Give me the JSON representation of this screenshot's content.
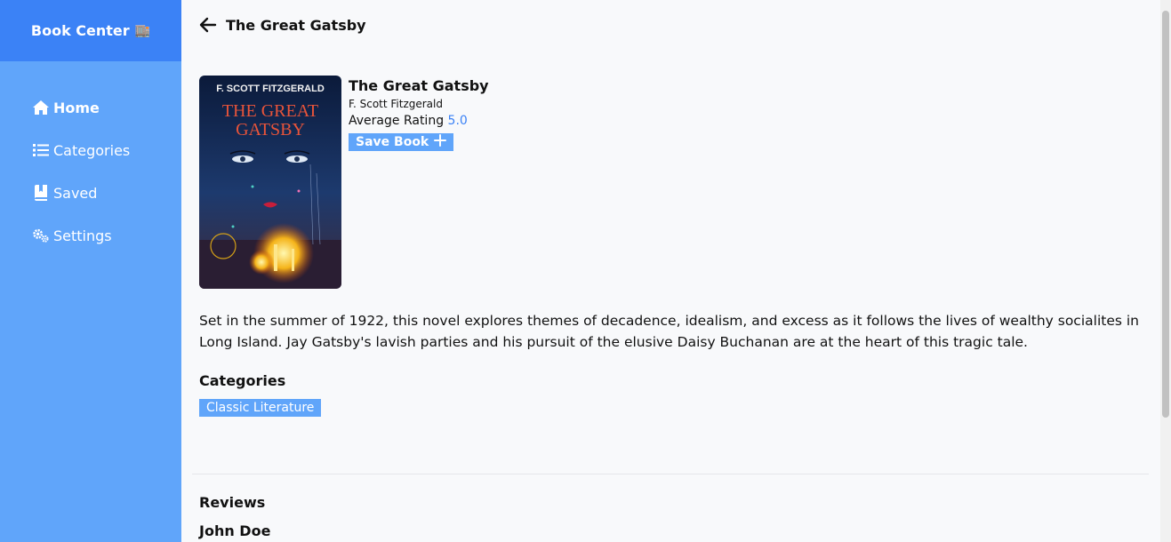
{
  "app": {
    "brand": "Book Center",
    "brand_emoji": "🏬"
  },
  "sidebar": {
    "items": [
      {
        "label": "Home",
        "icon": "home-icon",
        "active": true
      },
      {
        "label": "Categories",
        "icon": "list-icon",
        "active": false
      },
      {
        "label": "Saved",
        "icon": "book-bookmark-icon",
        "active": false
      },
      {
        "label": "Settings",
        "icon": "gears-icon",
        "active": false
      }
    ]
  },
  "header": {
    "title": "The Great Gatsby"
  },
  "book": {
    "cover_author": "F. SCOTT FITZGERALD",
    "cover_title_line1": "THE GREAT",
    "cover_title_line2": "GATSBY",
    "title": "The Great Gatsby",
    "author": "F. Scott Fitzgerald",
    "rating_label": "Average Rating",
    "rating_value": "5.0",
    "save_label": "Save Book",
    "description": "Set in the summer of 1922, this novel explores themes of decadence, idealism, and excess as it follows the lives of wealthy socialites in Long Island. Jay Gatsby's lavish parties and his pursuit of the elusive Daisy Buchanan are at the heart of this tragic tale."
  },
  "categories": {
    "heading": "Categories",
    "items": [
      "Classic Literature"
    ]
  },
  "reviews": {
    "heading": "Reviews",
    "items": [
      {
        "author": "John Doe"
      }
    ]
  },
  "colors": {
    "sidebar": "#60a5fa",
    "brand": "#3b82f6",
    "accent": "#3b82f6"
  }
}
